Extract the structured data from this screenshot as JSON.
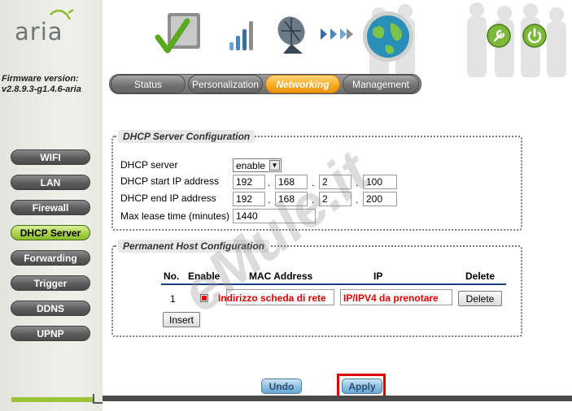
{
  "brand": {
    "logo_text": "aria"
  },
  "firmware": {
    "label": "Firmware version:",
    "value": "v2.8.9.3-g1.4.6-aria"
  },
  "tabs": [
    {
      "label": "Status",
      "active": false
    },
    {
      "label": "Personalization",
      "active": false
    },
    {
      "label": "Networking",
      "active": true
    },
    {
      "label": "Management",
      "active": false
    }
  ],
  "sidebar": {
    "items": [
      {
        "label": "WIFI",
        "active": false
      },
      {
        "label": "LAN",
        "active": false
      },
      {
        "label": "Firewall",
        "active": false
      },
      {
        "label": "DHCP Server",
        "active": true
      },
      {
        "label": "Forwarding",
        "active": false
      },
      {
        "label": "Trigger",
        "active": false
      },
      {
        "label": "DDNS",
        "active": false
      },
      {
        "label": "UPNP",
        "active": false
      }
    ]
  },
  "dhcp": {
    "legend": "DHCP Server Configuration",
    "server_label": "DHCP server",
    "server_value": "enable",
    "start_label": "DHCP start IP address",
    "start_ip": [
      "192",
      "168",
      "2",
      "100"
    ],
    "end_label": "DHCP end IP address",
    "end_ip": [
      "192",
      "168",
      "2",
      "200"
    ],
    "lease_label": "Max lease time (minutes)",
    "lease_value": "1440"
  },
  "hosts": {
    "legend": "Permanent Host Configuration",
    "columns": [
      "No.",
      "Enable",
      "MAC Address",
      "IP",
      "Delete"
    ],
    "rows": [
      {
        "no": "1",
        "mac_note": "Indirizzo scheda di rete",
        "ip_note": "IP/IPV4 da prenotare",
        "delete_label": "Delete"
      }
    ],
    "insert_label": "Insert"
  },
  "actions": {
    "undo": "Undo",
    "apply": "Apply"
  },
  "watermark": "eMule.it",
  "colors": {
    "accent_orange": "#f6a823",
    "active_green": "#a8d24a",
    "highlight_red": "#e00000",
    "nav_gray": "#5c5c5c"
  },
  "icons": {
    "header": [
      "checkmark-cube-icon",
      "signal-bars-icon",
      "satellite-dish-icon",
      "arrows-icon",
      "globe-icon"
    ],
    "top_right": [
      "wrench-icon",
      "power-icon"
    ]
  }
}
